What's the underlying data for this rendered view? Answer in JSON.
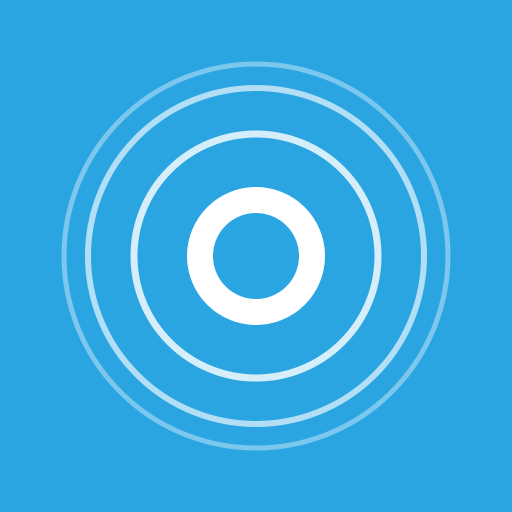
{
  "icon": {
    "name": "broadcast-rings-icon",
    "background_color": "#2ba5e1",
    "core_color": "#ffffff",
    "ring_inner_color": "#d6eefa",
    "ring_middle_color": "#b2dff5",
    "ring_outer_color": "#7cc7ee"
  }
}
